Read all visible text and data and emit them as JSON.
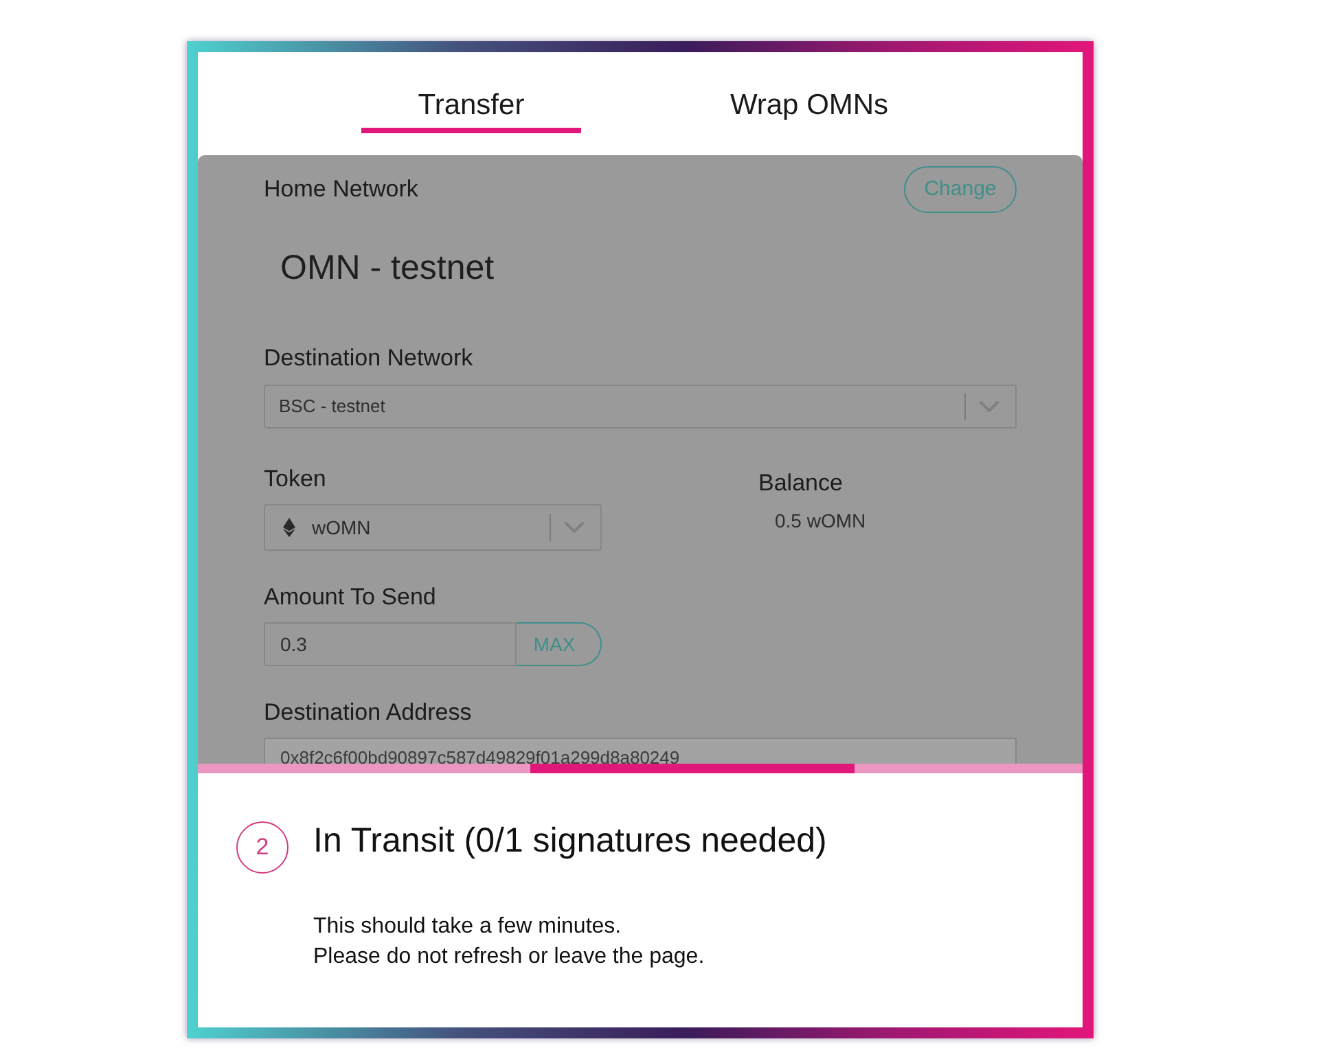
{
  "tabs": [
    {
      "label": "Transfer",
      "selected": true
    },
    {
      "label": "Wrap OMNs",
      "selected": false
    }
  ],
  "form": {
    "home_network": {
      "label": "Home Network",
      "value": "OMN - testnet",
      "button": "Change"
    },
    "destination_network": {
      "label": "Destination Network",
      "value": "BSC - testnet"
    },
    "token": {
      "label": "Token",
      "value": "wOMN"
    },
    "balance": {
      "label": "Balance",
      "value": "0.5 wOMN"
    },
    "amount": {
      "label": "Amount To Send",
      "value": "0.3",
      "button": "MAX"
    },
    "destination_address": {
      "label": "Destination Address",
      "value": "0x8f2c6f00bd90897c587d49829f01a299d8a80249",
      "disabled": true
    }
  },
  "progress": {
    "indeterminate": true
  },
  "status": {
    "step": "2",
    "title": "In Transit (0/1 signatures needed)",
    "lines": [
      "This should take a few minutes.",
      "Please do not refresh or leave the page."
    ]
  }
}
